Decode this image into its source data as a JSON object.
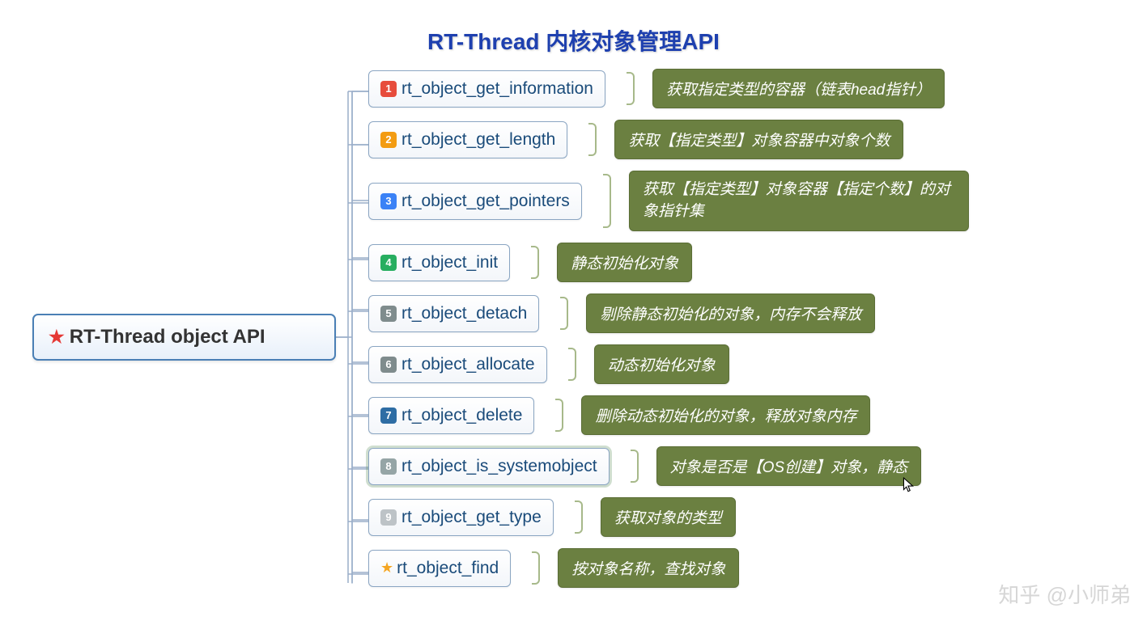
{
  "title": "RT-Thread 内核对象管理API",
  "root": {
    "label": "RT-Thread object API"
  },
  "badgeColors": {
    "1": "#e74c3c",
    "2": "#f39c12",
    "3": "#3b82f6",
    "4": "#27ae60",
    "5": "#7f8c8d",
    "6": "#7f8c8d",
    "7": "#2e6da4",
    "8": "#95a5a6",
    "9": "#bdc3c7"
  },
  "apis": [
    {
      "num": "1",
      "name": "rt_object_get_information",
      "desc": "获取指定类型的容器（链表head指针）",
      "multiline": false
    },
    {
      "num": "2",
      "name": "rt_object_get_length",
      "desc": "获取【指定类型】对象容器中对象个数",
      "multiline": false
    },
    {
      "num": "3",
      "name": "rt_object_get_pointers",
      "desc": "获取【指定类型】对象容器【指定个数】的对象指针集",
      "multiline": true
    },
    {
      "num": "4",
      "name": "rt_object_init",
      "desc": "静态初始化对象",
      "multiline": false
    },
    {
      "num": "5",
      "name": "rt_object_detach",
      "desc": "剔除静态初始化的对象，内存不会释放",
      "multiline": false
    },
    {
      "num": "6",
      "name": "rt_object_allocate",
      "desc": "动态初始化对象",
      "multiline": false
    },
    {
      "num": "7",
      "name": "rt_object_delete",
      "desc": "删除动态初始化的对象，释放对象内存",
      "multiline": false
    },
    {
      "num": "8",
      "name": "rt_object_is_systemobject",
      "desc": "对象是否是【OS创建】对象，静态",
      "multiline": false,
      "selected": true
    },
    {
      "num": "9",
      "name": "rt_object_get_type",
      "desc": "获取对象的类型",
      "multiline": false
    },
    {
      "num": "★",
      "name": "rt_object_find",
      "desc": "按对象名称，查找对象",
      "multiline": false,
      "star": true
    }
  ],
  "watermark": "知乎 @小师弟"
}
